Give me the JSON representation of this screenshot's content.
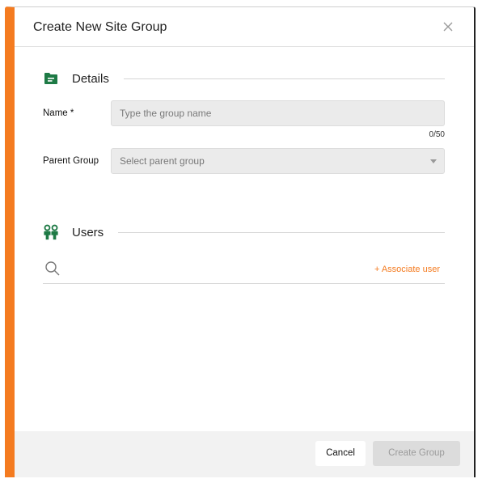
{
  "dialog": {
    "title": "Create New Site Group",
    "close_icon": "close-icon"
  },
  "details": {
    "heading": "Details",
    "icon": "folder-icon",
    "name": {
      "label": "Name *",
      "placeholder": "Type the group name",
      "value": "",
      "counter": "0/50"
    },
    "parent_group": {
      "label": "Parent Group",
      "placeholder": "Select parent group",
      "value": ""
    }
  },
  "users": {
    "heading": "Users",
    "icon": "users-icon",
    "search_icon": "search-icon",
    "associate_label": "+ Associate user"
  },
  "footer": {
    "cancel_label": "Cancel",
    "create_label": "Create Group"
  },
  "colors": {
    "accent": "#f47b20",
    "icon_green": "#1e7a45"
  }
}
